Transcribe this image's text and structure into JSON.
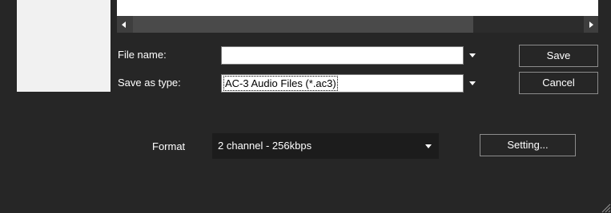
{
  "file_name": {
    "label": "File name:",
    "value": ""
  },
  "save_as_type": {
    "label": "Save as type:",
    "value": "AC-3 Audio Files (*.ac3)"
  },
  "buttons": {
    "save": "Save",
    "cancel": "Cancel",
    "setting": "Setting..."
  },
  "format": {
    "label": "Format",
    "value": "2 channel - 256kbps"
  },
  "colors": {
    "background": "#262626",
    "input_bg": "#ffffff",
    "button_border": "#8c8c8c"
  }
}
